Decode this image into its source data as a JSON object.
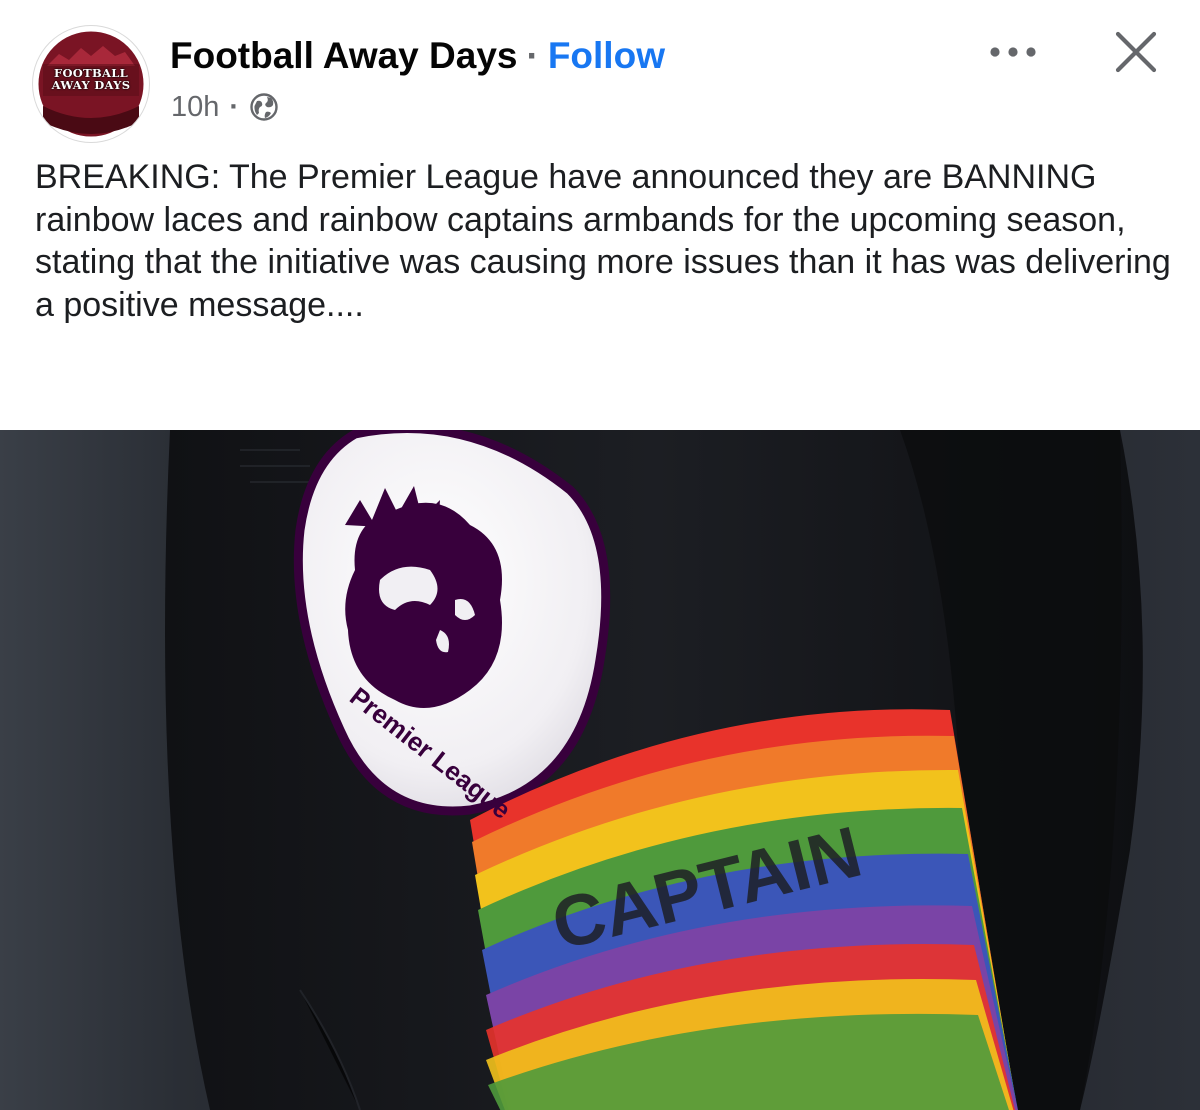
{
  "post": {
    "author": {
      "name": "Football Away Days",
      "avatar_text": [
        "FOOTBALL",
        "AWAY DAYS"
      ],
      "follow_label": "Follow",
      "separator": "·"
    },
    "meta": {
      "time": "10h",
      "separator": "·",
      "audience_icon": "globe-icon"
    },
    "actions": {
      "more_icon": "more-horizontal-icon",
      "close_icon": "close-icon"
    },
    "text": "BREAKING: The Premier League have announced they are BANNING rainbow laces and rainbow captains armbands for the upcoming season, stating that the initiative was causing more issues than it has was delivering a positive message....",
    "photo": {
      "badge_text": "Premier League",
      "armband_text": "CAPTAIN"
    }
  },
  "colors": {
    "follow_blue": "#1877f2",
    "meta_gray": "#65676b",
    "shirt_dark": "#1b1d22",
    "badge_purple": "#38003c"
  }
}
